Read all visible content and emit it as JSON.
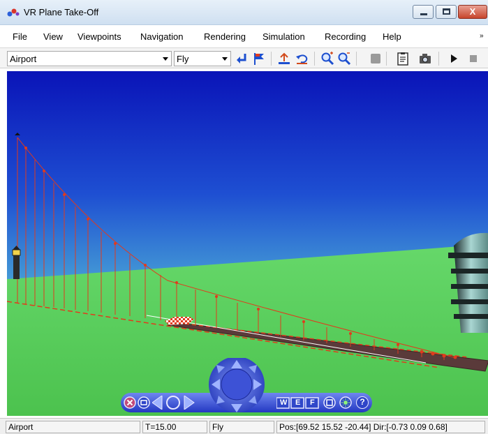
{
  "window": {
    "title": "VR Plane Take-Off",
    "close_label": "X"
  },
  "menu": {
    "items": [
      "File",
      "View",
      "Viewpoints",
      "Navigation",
      "Rendering",
      "Simulation",
      "Recording",
      "Help"
    ],
    "more_glyph": "»"
  },
  "toolbar": {
    "viewpoint": {
      "value": "Airport"
    },
    "nav_mode": {
      "value": "Fly"
    },
    "icons": [
      "return-icon",
      "flag-icon",
      "straighten-icon",
      "undo-move-icon",
      "zoom-in-icon",
      "zoom-out-icon",
      "record-icon",
      "clipboard-icon",
      "camera-icon",
      "play-icon",
      "stop-icon"
    ]
  },
  "nav_panel": {
    "mode_buttons": [
      "W",
      "E",
      "F"
    ],
    "help_label": "?"
  },
  "status": {
    "viewpoint": "Airport",
    "time": "T=15.00",
    "mode": "Fly",
    "position": "Pos:[69.52 15.52 -20.44] Dir:[-0.73 0.09 0.68]"
  },
  "colors": {
    "sky_top": "#0a14b8",
    "sky_bottom": "#4aa6d6",
    "ground": "#5ad05a",
    "cable": "#e23a1c",
    "runway": "#5a3a3a"
  }
}
